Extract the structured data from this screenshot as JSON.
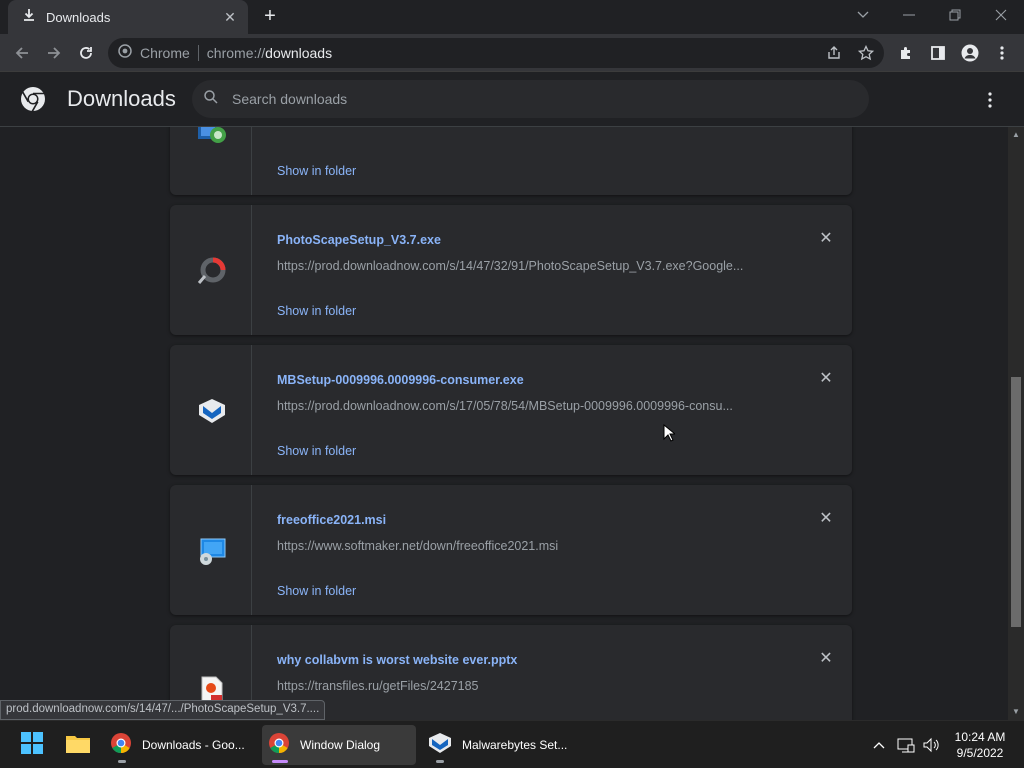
{
  "tab": {
    "title": "Downloads",
    "close_icon": "close-icon"
  },
  "toolbar": {
    "omnibox_label": "Chrome",
    "url_scheme": "chrome://",
    "url_path": "downloads"
  },
  "header": {
    "title": "Downloads",
    "search_placeholder": "Search downloads"
  },
  "downloads": [
    {
      "name": "",
      "url": "",
      "action": "Show in folder",
      "icon": "installer-icon"
    },
    {
      "name": "PhotoScapeSetup_V3.7.exe",
      "url": "https://prod.downloadnow.com/s/14/47/32/91/PhotoScapeSetup_V3.7.exe?Google...",
      "action": "Show in folder",
      "icon": "photoscape-icon"
    },
    {
      "name": "MBSetup-0009996.0009996-consumer.exe",
      "url": "https://prod.downloadnow.com/s/17/05/78/54/MBSetup-0009996.0009996-consu...",
      "action": "Show in folder",
      "icon": "malwarebytes-icon"
    },
    {
      "name": "freeoffice2021.msi",
      "url": "https://www.softmaker.net/down/freeoffice2021.msi",
      "action": "Show in folder",
      "icon": "msi-installer-icon"
    },
    {
      "name": "why collabvm is worst website ever.pptx",
      "url": "https://transfiles.ru/getFiles/2427185",
      "action": "",
      "icon": "pptx-file-icon"
    }
  ],
  "status_bubble": "prod.downloadnow.com/s/14/47/.../PhotoScapeSetup_V3.7....",
  "taskbar": {
    "items": [
      {
        "label": "Downloads - Goo..."
      },
      {
        "label": "Window Dialog"
      },
      {
        "label": "Malwarebytes Set..."
      }
    ],
    "time": "10:24 AM",
    "date": "9/5/2022"
  },
  "colors": {
    "accent_link": "#8ab4f8",
    "background": "#202124",
    "card": "#292a2d"
  }
}
